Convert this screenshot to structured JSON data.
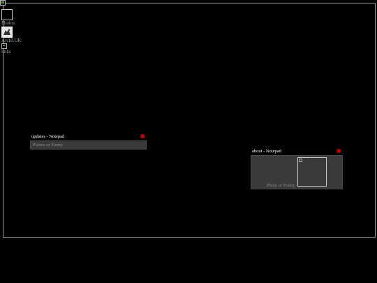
{
  "desktop": {
    "icons": [
      {
        "label": "Photos",
        "icon": "photos-icon"
      },
      {
        "label": "ArchLUK",
        "icon": "archluk-icon"
      },
      {
        "label": "links",
        "icon": "links-icon"
      }
    ]
  },
  "windows": {
    "updates": {
      "title": "updates - Notepad",
      "body": "Photos or Poetry",
      "close_label": "x"
    },
    "about": {
      "title": "about - Notepad",
      "body": "Photo or Poetry",
      "close_label": "x"
    }
  },
  "colors": {
    "background": "#000000",
    "window_body": "#3a3a3a",
    "close_button": "#c00000",
    "border": "#9a9a9a"
  }
}
